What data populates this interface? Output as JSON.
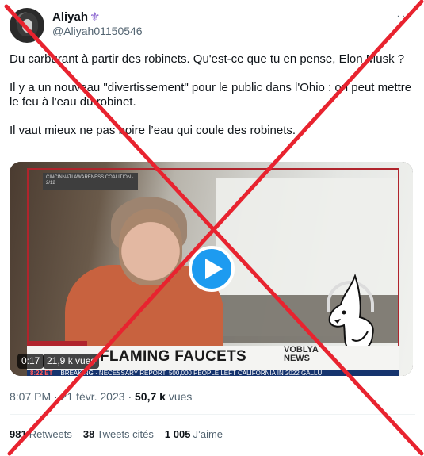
{
  "author": {
    "name": "Aliyah",
    "badge_glyph": "⚜",
    "handle": "@Aliyah01150546"
  },
  "tweet": {
    "paragraphs": [
      "Du carburant à partir des robinets. Qu'est-ce que tu en pense, Elon Musk ?",
      "Il y a un nouveau \"divertissement\" pour le public dans l'Ohio : on peut mettre le feu à l'eau du robinet.",
      "Il vaut mieux ne pas boire l’eau qui coule des robinets."
    ]
  },
  "video": {
    "corner_caption": "CINCINNATI AWARENESS COALITION · 2/12",
    "headline": "FLAMING FAUCETS",
    "network_line1": "VOBLYA",
    "network_line2": "NEWS",
    "ticker_tag": "8:22 ET",
    "ticker_text": "BREAKING · NECESSARY   REPORT: 500,000 PEOPLE LEFT CALIFORNIA IN 2022   GALLU",
    "time": "0:17",
    "views": "21,9 k vues"
  },
  "meta": {
    "time": "8:07 PM",
    "separator": "·",
    "date": "21 févr. 2023",
    "views_count": "50,7 k",
    "views_label": "vues"
  },
  "stats": {
    "retweets_count": "981",
    "retweets_label": "Retweets",
    "quotes_count": "38",
    "quotes_label": "Tweets cités",
    "likes_count": "1 005",
    "likes_label": "J’aime"
  },
  "overlay": {
    "cross_color": "#e8232f"
  },
  "colors": {
    "accent": "#1d9bf0",
    "secondary_text": "#536471"
  }
}
